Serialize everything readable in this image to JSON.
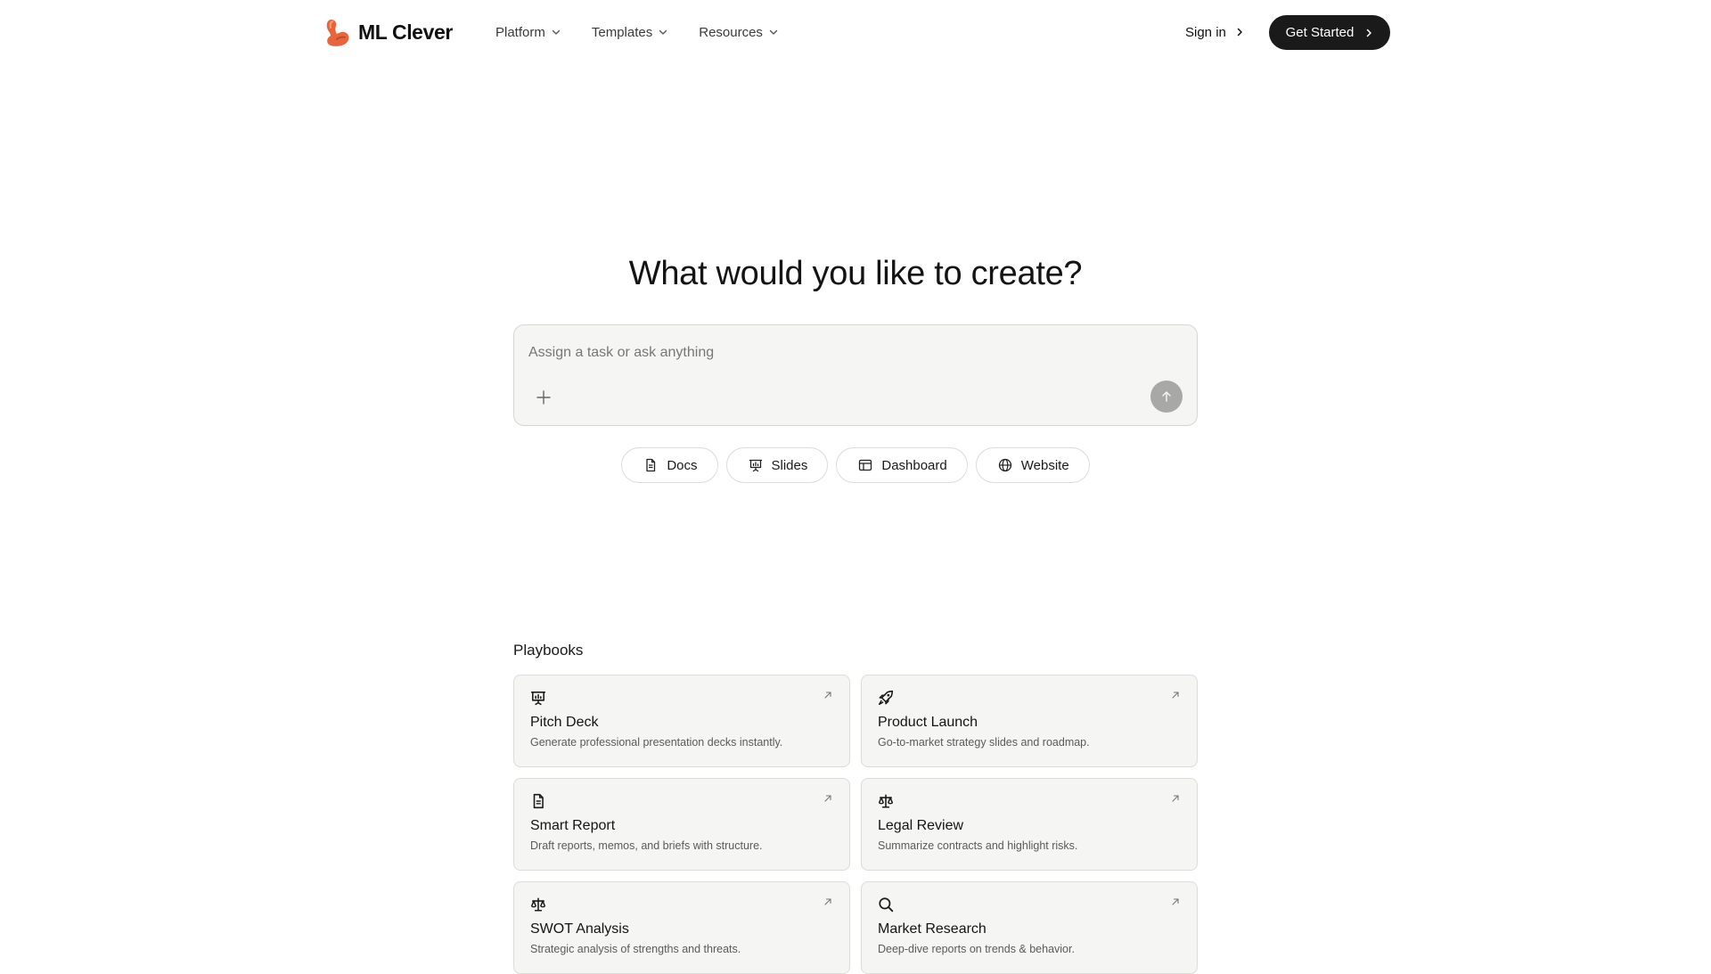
{
  "brand": {
    "name": "ML Clever",
    "logo_icon": "flexed-arm-logo-icon",
    "logo_color": "#e8643c"
  },
  "nav": {
    "items": [
      {
        "label": "Platform",
        "icon": "chevron-down-icon"
      },
      {
        "label": "Templates",
        "icon": "chevron-down-icon"
      },
      {
        "label": "Resources",
        "icon": "chevron-down-icon"
      }
    ],
    "sign_in": "Sign in",
    "get_started": "Get Started"
  },
  "hero": {
    "title": "What would you like to create?",
    "input_placeholder": "Assign a task or ask anything",
    "input_value": ""
  },
  "chips": [
    {
      "label": "Docs",
      "icon": "document-icon"
    },
    {
      "label": "Slides",
      "icon": "presentation-icon"
    },
    {
      "label": "Dashboard",
      "icon": "dashboard-icon"
    },
    {
      "label": "Website",
      "icon": "globe-icon"
    }
  ],
  "playbooks": {
    "heading": "Playbooks",
    "cards": [
      {
        "title": "Pitch Deck",
        "description": "Generate professional presentation decks instantly.",
        "icon": "presentation-icon"
      },
      {
        "title": "Product Launch",
        "description": "Go-to-market strategy slides and roadmap.",
        "icon": "rocket-icon"
      },
      {
        "title": "Smart Report",
        "description": "Draft reports, memos, and briefs with structure.",
        "icon": "document-icon"
      },
      {
        "title": "Legal Review",
        "description": "Summarize contracts and highlight risks.",
        "icon": "scales-icon"
      },
      {
        "title": "SWOT Analysis",
        "description": "Strategic analysis of strengths and threats.",
        "icon": "scales-icon"
      },
      {
        "title": "Market Research",
        "description": "Deep-dive reports on trends & behavior.",
        "icon": "search-icon"
      }
    ]
  },
  "colors": {
    "primary_button": "#1a1a1a",
    "surface": "#f5f5f3",
    "border": "#dcdcd8",
    "send_button": "#a8a8a6"
  }
}
